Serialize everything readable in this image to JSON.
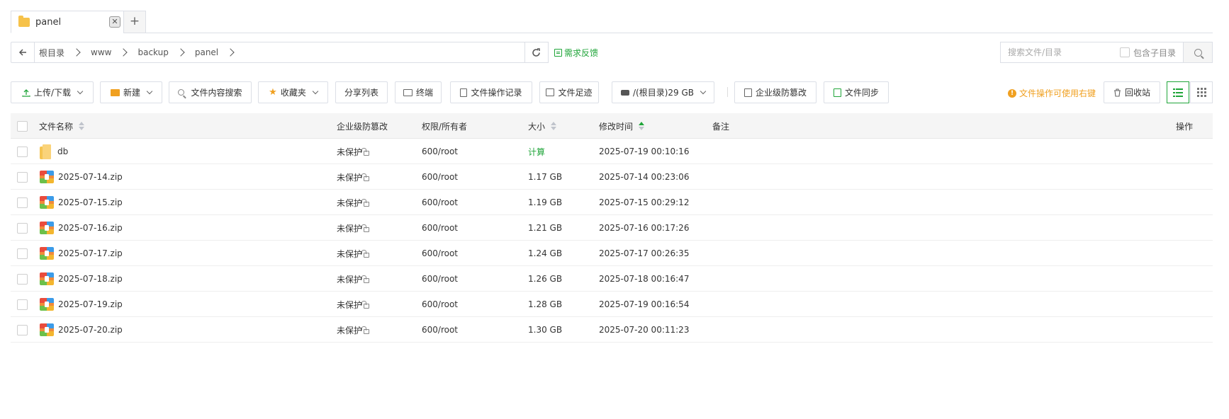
{
  "tab": {
    "label": "panel",
    "close": "✕",
    "add": "+"
  },
  "path": {
    "crumbs": [
      "根目录",
      "www",
      "backup",
      "panel"
    ],
    "feedback": "需求反馈"
  },
  "search": {
    "placeholder": "搜索文件/目录",
    "subdir_label": "包含子目录"
  },
  "toolbar": {
    "upload": "上传/下载",
    "new": "新建",
    "content_search": "文件内容搜索",
    "favorites": "收藏夹",
    "share_list": "分享列表",
    "terminal": "终端",
    "op_log": "文件操作记录",
    "footprint": "文件足迹",
    "disk": "/(根目录)29 GB",
    "tamper": "企业级防篡改",
    "sync": "文件同步",
    "hint": "文件操作可使用右键",
    "recycle": "回收站"
  },
  "table": {
    "headers": {
      "name": "文件名称",
      "tamper": "企业级防篡改",
      "perm": "权限/所有者",
      "size": "大小",
      "mtime": "修改时间",
      "remark": "备注",
      "ops": "操作"
    },
    "rows": [
      {
        "name": "db",
        "type": "folder",
        "tamper": "未保护",
        "perm": "600/root",
        "size": "计算",
        "mtime": "2025-07-19 00:10:16"
      },
      {
        "name": "2025-07-14.zip",
        "type": "zip",
        "tamper": "未保护",
        "perm": "600/root",
        "size": "1.17 GB",
        "mtime": "2025-07-14 00:23:06"
      },
      {
        "name": "2025-07-15.zip",
        "type": "zip",
        "tamper": "未保护",
        "perm": "600/root",
        "size": "1.19 GB",
        "mtime": "2025-07-15 00:29:12"
      },
      {
        "name": "2025-07-16.zip",
        "type": "zip",
        "tamper": "未保护",
        "perm": "600/root",
        "size": "1.21 GB",
        "mtime": "2025-07-16 00:17:26"
      },
      {
        "name": "2025-07-17.zip",
        "type": "zip",
        "tamper": "未保护",
        "perm": "600/root",
        "size": "1.24 GB",
        "mtime": "2025-07-17 00:26:35"
      },
      {
        "name": "2025-07-18.zip",
        "type": "zip",
        "tamper": "未保护",
        "perm": "600/root",
        "size": "1.26 GB",
        "mtime": "2025-07-18 00:16:47"
      },
      {
        "name": "2025-07-19.zip",
        "type": "zip",
        "tamper": "未保护",
        "perm": "600/root",
        "size": "1.28 GB",
        "mtime": "2025-07-19 00:16:54"
      },
      {
        "name": "2025-07-20.zip",
        "type": "zip",
        "tamper": "未保护",
        "perm": "600/root",
        "size": "1.30 GB",
        "mtime": "2025-07-20 00:11:23"
      }
    ]
  },
  "colors": {
    "accent": "#20a53a",
    "warning": "#f0a020",
    "border": "#dcdfe6"
  }
}
